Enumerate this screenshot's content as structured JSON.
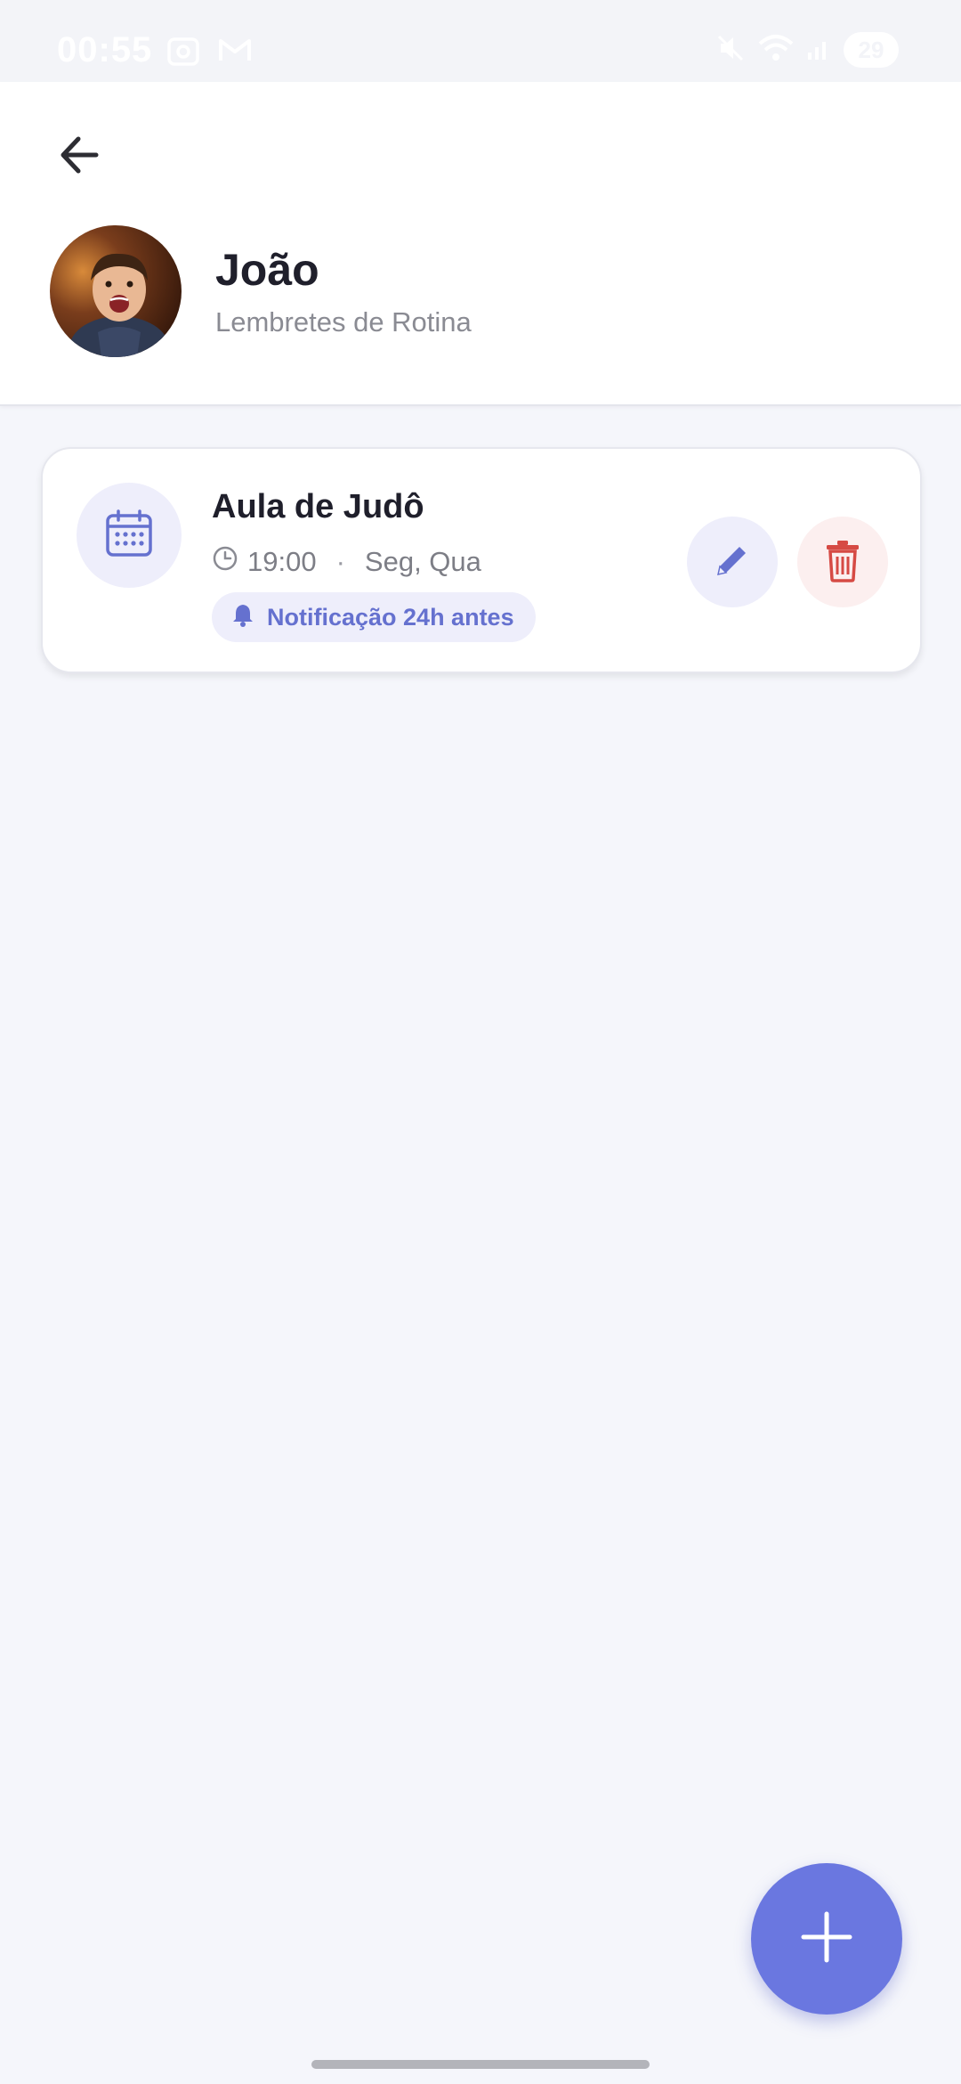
{
  "status_bar": {
    "time": "00:55",
    "battery": "29",
    "icons": [
      "screenshot-icon",
      "gmail-icon",
      "mute-icon",
      "wifi-icon",
      "signal-icon",
      "battery-icon"
    ]
  },
  "header": {
    "back_icon": "arrow-left-icon",
    "name": "João",
    "subtitle": "Lembretes de Rotina"
  },
  "reminders": [
    {
      "icon": "calendar-icon",
      "title": "Aula de Judô",
      "time": "19:00",
      "separator": "·",
      "days": "Seg, Qua",
      "notification": "Notificação 24h antes",
      "edit_icon": "pencil-icon",
      "delete_icon": "trash-icon"
    }
  ],
  "fab": {
    "icon": "plus-icon"
  },
  "colors": {
    "accent": "#6a77e0",
    "accent_text": "#6571cf",
    "accent_soft": "#eeeefb",
    "danger": "#d64a44",
    "danger_soft": "#fcefef",
    "background": "#f5f6fb",
    "surface": "#ffffff"
  }
}
